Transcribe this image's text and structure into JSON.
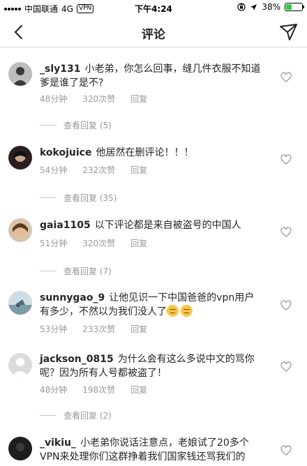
{
  "status_bar": {
    "carrier": "中国联通",
    "network": "4G",
    "vpn": "VPN",
    "time": "下午4:24",
    "battery_percent": "38%",
    "battery_level": 0.38,
    "colors": {
      "battery": "#2ecc40"
    }
  },
  "nav": {
    "title": "评论",
    "back_icon": "chevron-left-icon",
    "send_icon": "paper-plane-icon"
  },
  "comments": [
    {
      "username": "_sly131",
      "text": "小老弟，你怎么回事，缝几件衣服不知道爹是谁了是不?",
      "time": "48分钟",
      "likes": "320次赞",
      "reply": "回复",
      "view_replies": "查看回复 (5)",
      "avatar_color": "#5a5a5a"
    },
    {
      "username": "kokojuice",
      "text": "他居然在删评论！！！",
      "time": "54分钟",
      "likes": "232次赞",
      "reply": "回复",
      "view_replies": "查看回复 (35)",
      "avatar_color": "#3d2b2b"
    },
    {
      "username": "gaia1105",
      "text": "以下评论都是来自被盗号的中国人",
      "time": "51分钟",
      "likes": "320次赞",
      "reply": "回复",
      "view_replies": "查看回复 (7)",
      "avatar_color": "#b08a6a"
    },
    {
      "username": "sunnygao_9",
      "text": "让他见识一下中国爸爸的vpn用户有多少，不然以为我们没人了",
      "time": "53分钟",
      "likes": "233次赞",
      "reply": "回复",
      "view_replies": "",
      "avatar_color": "#8fa9b8"
    },
    {
      "username": "jackson_0815",
      "text": "为什么会有这么多说中文的骂你呢？因为所有人号都被盗了！",
      "time": "48分钟",
      "likes": "198次赞",
      "reply": "回复",
      "view_replies": "查看回复 (2)",
      "avatar_color": "#d9d9d9"
    },
    {
      "username": "_vikiu_",
      "text": "小老弟你说话注意点，老娘试了20多个VPN来处理你们这群挣着我们国家钱还骂我们的",
      "time": "",
      "likes": "",
      "reply": "",
      "view_replies": "",
      "avatar_color": "#2b2b2b"
    }
  ]
}
